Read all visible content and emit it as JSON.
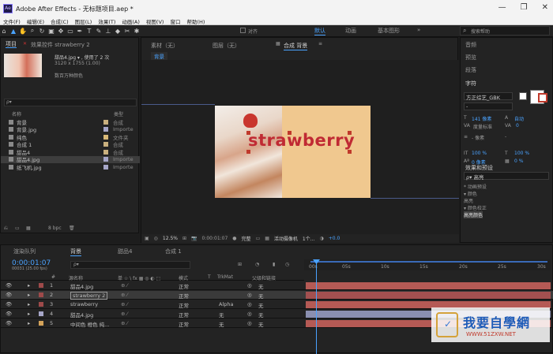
{
  "window": {
    "title": "Adobe After Effects - 无标题项目.aep *",
    "app_icon": "Ae",
    "controls": [
      "—",
      "❐",
      "✕"
    ]
  },
  "menu": [
    "文件(F)",
    "编辑(E)",
    "合成(C)",
    "图层(L)",
    "效果(T)",
    "动画(A)",
    "视图(V)",
    "窗口",
    "帮助(H)"
  ],
  "toolbar": {
    "align_label": "对齐",
    "workspaces": [
      "默认",
      "动画",
      "基本图形"
    ],
    "workspace_active": "默认",
    "search_placeholder": "搜索帮助"
  },
  "project": {
    "tabs": [
      "项目",
      "效果控件 strawberry 2"
    ],
    "tab_menu": "≡",
    "footage": {
      "name": "甜品4.jpg ▾ , 使用了 2 次",
      "size": "3120 x 1755 (1.00)",
      "colors": "数百万种颜色"
    },
    "search_placeholder": "ρ▾",
    "headers": {
      "name": "名称",
      "type": "类型"
    },
    "items": [
      {
        "name": "背景",
        "type": "合成",
        "color": "#c9b07e"
      },
      {
        "name": "背景.jpg",
        "type": "Importe",
        "color": "#a6a6c8"
      },
      {
        "name": "纯色",
        "type": "文件夹",
        "color": "#d9b978"
      },
      {
        "name": "合成 1",
        "type": "合成",
        "color": "#c9b07e"
      },
      {
        "name": "甜品4",
        "type": "合成",
        "color": "#c9b07e"
      },
      {
        "name": "甜品4.jpg",
        "type": "Importe",
        "color": "#a6a6c8"
      },
      {
        "name": "纸飞机.jpg",
        "type": "Importe",
        "color": "#a6a6c8"
      }
    ],
    "bit_depth": "8 bpc"
  },
  "viewer": {
    "tabs": [
      "素材（无）",
      "图层（无）",
      "合成 背景"
    ],
    "breadcrumb": "背景",
    "overlay_text": "strawberry",
    "zoom": "12.5%",
    "timecode": "0:00:01:07",
    "resolution": "完整",
    "camera": "活动摄像机",
    "views": "1个...",
    "offset": "+0.0"
  },
  "right": {
    "items": [
      "音频",
      "预览",
      "段落"
    ],
    "character": {
      "title": "字符",
      "font": "方正综艺_GBK",
      "style": "-",
      "size": "141 像素",
      "leading": "自动",
      "kerning": "度量标准",
      "tracking": "0",
      "stroke": "- 像素",
      "stroke_type": "-",
      "vscale": "100 %",
      "hscale": "100 %",
      "baseline": "0 像素",
      "tsume": "0 %"
    },
    "effects": {
      "title": "效果和预设",
      "search": "ρ▾ 高亮",
      "items": [
        "* 动画预设",
        "  ▾ 颜色",
        "    高亮",
        "▾ 颜色校正",
        "    高亮颜色"
      ]
    }
  },
  "timeline": {
    "tabs": [
      "渲染队列",
      "背景",
      "甜品4",
      "合成 1"
    ],
    "timecode": "0:00:01:07",
    "frames": "00031 (25.00 fps)",
    "search_placeholder": "ρ▾",
    "headers": {
      "num": "#",
      "source": "源名称",
      "switches": "单 ☆ \\ fx ▦ ◎ ◐ ⬚",
      "mode": "模式",
      "t": "T",
      "trkmat": "TrkMat",
      "parent": "父级和链接"
    },
    "ruler": [
      "00s",
      "05s",
      "10s",
      "15s",
      "20s",
      "25s",
      "30s"
    ],
    "layers": [
      {
        "num": "1",
        "name": "甜品4.jpg",
        "mode": "正常",
        "trk": "",
        "parent": "无",
        "label": "#9e4a4a",
        "bar": "#b55a55"
      },
      {
        "num": "2",
        "name": "strawberry 2",
        "mode": "正常",
        "trk": "",
        "parent": "无",
        "label": "#9e4a4a",
        "bar": "#a35050"
      },
      {
        "num": "3",
        "name": "strawberry",
        "mode": "正常",
        "trk": "Alpha",
        "parent": "无",
        "label": "#9e4a4a",
        "bar": "#b55a55"
      },
      {
        "num": "4",
        "name": "甜品4.jpg",
        "mode": "正常",
        "trk": "无",
        "parent": "无",
        "label": "#a6a6c8",
        "bar": "#8a8fb0"
      },
      {
        "num": "5",
        "name": "中间色 橙色 纯...",
        "mode": "正常",
        "trk": "无",
        "parent": "无",
        "label": "#d4a35a",
        "bar": "#b55a55"
      }
    ]
  },
  "watermark": {
    "text": "我要自學網",
    "url": "WWW.51ZXW.NET"
  }
}
